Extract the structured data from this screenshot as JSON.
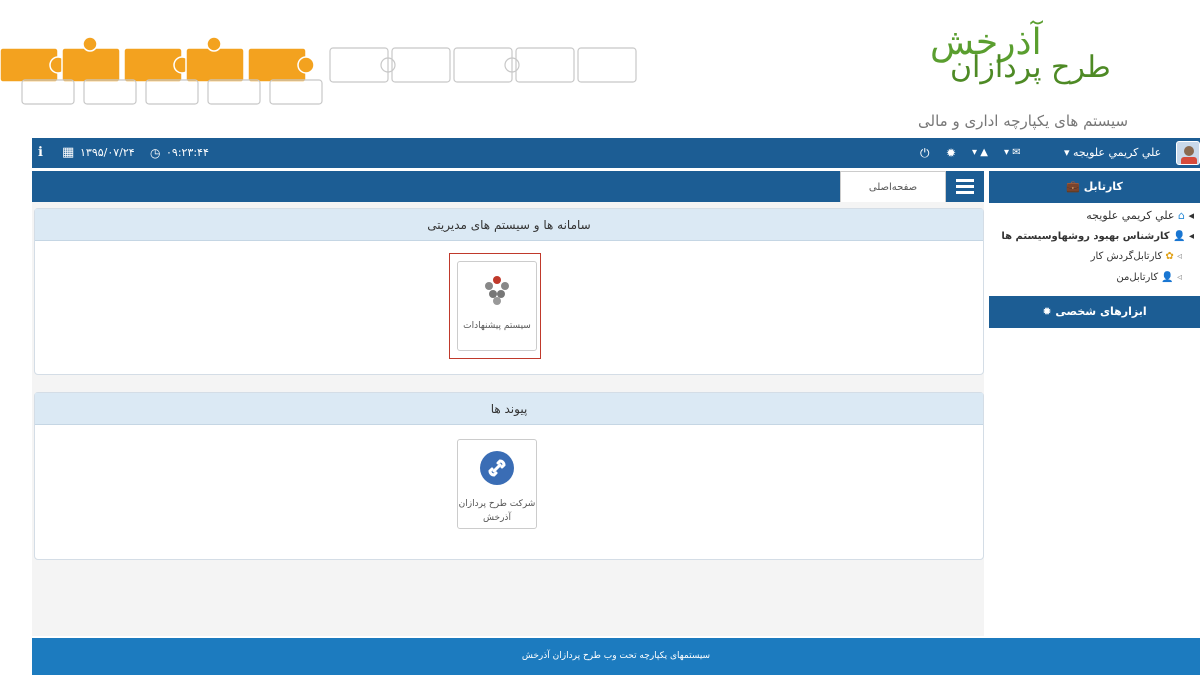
{
  "header": {
    "logo_main": "طرح پردازان",
    "logo_script": "آذرخش",
    "tagline": "سیستم های یکپارچه اداری و مالی"
  },
  "topbar": {
    "time": "۰۹:۲۳:۴۴",
    "date": "۱۳۹۵/۰۷/۲۴",
    "user_name": "علي كريمي علويجه"
  },
  "nav": {
    "home_tab": "صفحه‌اصلی"
  },
  "sidebar": {
    "cartable_header": "کارتابل",
    "tree": [
      {
        "label": "علي كريمي علويجه"
      },
      {
        "label": "کارشناس بهبود روشهاوسیستم ها"
      },
      {
        "label": "کارتابل‌گردش کار"
      },
      {
        "label": "کارتابل‌من"
      }
    ],
    "tools_header": "ابزارهای شخصی"
  },
  "panels": {
    "systems": {
      "title": "سامانه ها و سیستم های مدیریتی",
      "tile_label": "سیستم پیشنهادات"
    },
    "links": {
      "title": "پیوند ها",
      "tile_label": "شرکت طرح پردازان آذرخش"
    }
  },
  "footer": {
    "text": "سیستمهای یکپارچه تحت وب طرح پردازان آذرخش"
  },
  "colors": {
    "primary_bar": "#1c5d94",
    "footer": "#1c7bbf",
    "panel_head": "#dbe9f4",
    "logo_green": "#5a9e2f",
    "highlight_border": "#c0392b"
  }
}
